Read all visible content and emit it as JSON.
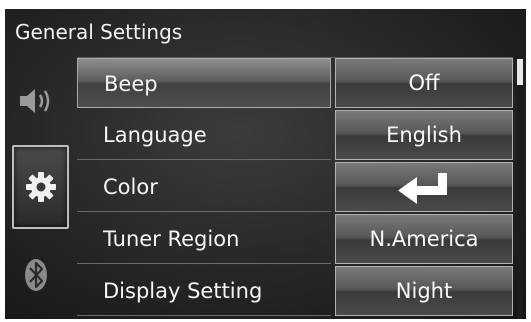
{
  "header": {
    "title": "General Settings"
  },
  "sidebar": {
    "tabs": [
      {
        "icon": "speaker-icon",
        "active": false
      },
      {
        "icon": "gear-icon",
        "active": true
      },
      {
        "icon": "bluetooth-icon",
        "active": false
      }
    ]
  },
  "settings": {
    "rows": [
      {
        "label": "Beep",
        "value": "Off"
      },
      {
        "label": "Language",
        "value": "English"
      },
      {
        "label": "Color",
        "value_icon": "enter-arrow-icon"
      },
      {
        "label": "Tuner Region",
        "value": "N.America"
      },
      {
        "label": "Display Setting",
        "value": "Night"
      }
    ]
  },
  "colors": {
    "text": "#f5f5f5",
    "background": "#262626",
    "highlight": "#8e8e8e"
  }
}
